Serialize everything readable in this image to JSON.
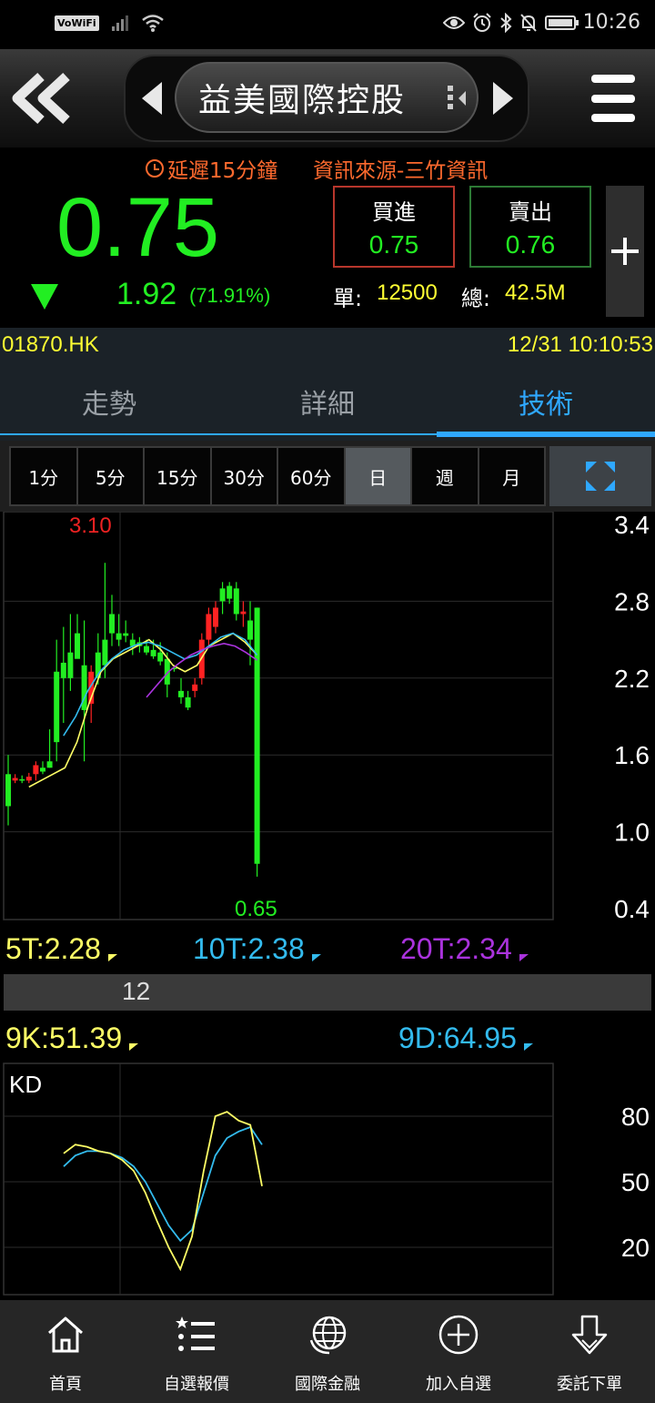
{
  "status_bar": {
    "network": "VoWiFi",
    "time": "10:26"
  },
  "header": {
    "title": "益美國際控股"
  },
  "quote": {
    "delay_note": "延遲15分鐘",
    "source": "資訊來源-三竹資訊",
    "price": "0.75",
    "change": "1.92",
    "change_pct": "(71.91%)",
    "buy_label": "買進",
    "buy_price": "0.75",
    "sell_label": "賣出",
    "sell_price": "0.76",
    "lot_label": "單:",
    "lot_value": "12500",
    "total_label": "總:",
    "total_value": "42.5M"
  },
  "info": {
    "code": "01870.HK",
    "datetime": "12/31 10:10:53"
  },
  "tabs": [
    {
      "label": "走勢"
    },
    {
      "label": "詳細"
    },
    {
      "label": "技術"
    }
  ],
  "active_tab": "技術",
  "periods": [
    {
      "label": "1分"
    },
    {
      "label": "5分"
    },
    {
      "label": "15分"
    },
    {
      "label": "30分"
    },
    {
      "label": "60分"
    },
    {
      "label": "日"
    },
    {
      "label": "週"
    },
    {
      "label": "月"
    }
  ],
  "active_period": "日",
  "price_chart": {
    "y_ticks": [
      "3.4",
      "2.8",
      "2.2",
      "1.6",
      "1.0",
      "0.4"
    ],
    "high_label": "3.10",
    "low_label": "0.65"
  },
  "ma": {
    "ma5": "5T:2.28",
    "ma10": "10T:2.38",
    "ma20": "20T:2.34"
  },
  "month_marker": "12",
  "kd": {
    "k": "9K:51.39",
    "d": "9D:64.95",
    "label": "KD",
    "y_ticks": [
      "80",
      "50",
      "20"
    ]
  },
  "colors": {
    "up": "#ff2222",
    "down": "#22ee22",
    "ma5": "#ffff66",
    "ma10": "#33bbee",
    "ma20": "#aa33dd",
    "accent": "#2fa8ff"
  },
  "chart_data": {
    "type": "candlestick",
    "y_unit": "HKD",
    "ylim": [
      0.4,
      3.4
    ],
    "candles": [
      {
        "o": 1.45,
        "h": 1.6,
        "l": 1.05,
        "c": 1.2
      },
      {
        "o": 1.4,
        "h": 1.45,
        "l": 1.38,
        "c": 1.42
      },
      {
        "o": 1.41,
        "h": 1.44,
        "l": 1.38,
        "c": 1.4
      },
      {
        "o": 1.4,
        "h": 1.46,
        "l": 1.38,
        "c": 1.43
      },
      {
        "o": 1.45,
        "h": 1.55,
        "l": 1.4,
        "c": 1.52
      },
      {
        "o": 1.5,
        "h": 1.55,
        "l": 1.45,
        "c": 1.47
      },
      {
        "o": 1.55,
        "h": 1.8,
        "l": 1.5,
        "c": 1.5
      },
      {
        "o": 2.25,
        "h": 2.5,
        "l": 1.55,
        "c": 1.7
      },
      {
        "o": 2.32,
        "h": 2.6,
        "l": 1.85,
        "c": 2.2
      },
      {
        "o": 2.4,
        "h": 2.7,
        "l": 2.1,
        "c": 2.2
      },
      {
        "o": 2.55,
        "h": 2.7,
        "l": 2.4,
        "c": 2.35
      },
      {
        "o": 2.3,
        "h": 2.65,
        "l": 1.55,
        "c": 1.95
      },
      {
        "o": 2.0,
        "h": 2.3,
        "l": 1.85,
        "c": 2.25
      },
      {
        "o": 2.4,
        "h": 2.55,
        "l": 2.15,
        "c": 2.2
      },
      {
        "o": 2.5,
        "h": 3.1,
        "l": 2.2,
        "c": 2.3
      },
      {
        "o": 2.7,
        "h": 2.85,
        "l": 2.45,
        "c": 2.55
      },
      {
        "o": 2.55,
        "h": 2.7,
        "l": 2.45,
        "c": 2.5
      },
      {
        "o": 2.55,
        "h": 2.65,
        "l": 2.48,
        "c": 2.53
      },
      {
        "o": 2.5,
        "h": 2.55,
        "l": 2.38,
        "c": 2.45
      },
      {
        "o": 2.48,
        "h": 2.52,
        "l": 2.4,
        "c": 2.45
      },
      {
        "o": 2.45,
        "h": 2.5,
        "l": 2.38,
        "c": 2.4
      },
      {
        "o": 2.42,
        "h": 2.5,
        "l": 2.35,
        "c": 2.37
      },
      {
        "o": 2.4,
        "h": 2.48,
        "l": 2.3,
        "c": 2.33
      },
      {
        "o": 2.35,
        "h": 2.4,
        "l": 2.05,
        "c": 2.15
      },
      {
        "o": 2.28,
        "h": 2.3,
        "l": 2.25,
        "c": 2.27
      },
      {
        "o": 2.1,
        "h": 2.2,
        "l": 2.0,
        "c": 2.05
      },
      {
        "o": 2.05,
        "h": 2.1,
        "l": 1.95,
        "c": 1.97
      },
      {
        "o": 2.1,
        "h": 2.2,
        "l": 2.05,
        "c": 2.15
      },
      {
        "o": 2.2,
        "h": 2.55,
        "l": 2.15,
        "c": 2.5
      },
      {
        "o": 2.5,
        "h": 2.75,
        "l": 2.45,
        "c": 2.7
      },
      {
        "o": 2.6,
        "h": 2.8,
        "l": 2.55,
        "c": 2.75
      },
      {
        "o": 2.9,
        "h": 2.95,
        "l": 2.7,
        "c": 2.8
      },
      {
        "o": 2.92,
        "h": 2.95,
        "l": 2.78,
        "c": 2.82
      },
      {
        "o": 2.9,
        "h": 2.95,
        "l": 2.65,
        "c": 2.7
      },
      {
        "o": 2.7,
        "h": 2.8,
        "l": 2.6,
        "c": 2.72
      },
      {
        "o": 2.65,
        "h": 2.8,
        "l": 2.3,
        "c": 2.5
      },
      {
        "o": 2.75,
        "h": 2.75,
        "l": 0.65,
        "c": 0.75
      }
    ],
    "ma5_line": [
      1.35,
      1.4,
      1.45,
      1.5,
      1.7,
      2.0,
      2.25,
      2.35,
      2.4,
      2.45,
      2.5,
      2.42,
      2.3,
      2.25,
      2.3,
      2.45,
      2.5,
      2.55,
      2.48,
      2.38
    ],
    "ma10_line": [
      1.75,
      1.9,
      2.1,
      2.25,
      2.35,
      2.42,
      2.46,
      2.48,
      2.45,
      2.4,
      2.35,
      2.38,
      2.45,
      2.52,
      2.55,
      2.5,
      2.38
    ],
    "ma20_line": [
      2.05,
      2.15,
      2.25,
      2.32,
      2.38,
      2.42,
      2.45,
      2.47,
      2.45,
      2.4,
      2.34
    ],
    "kd_ylim": [
      0,
      100
    ],
    "k_line": [
      63,
      67,
      66,
      64,
      63,
      60,
      55,
      45,
      32,
      20,
      10,
      25,
      55,
      80,
      82,
      78,
      76,
      48
    ],
    "d_line": [
      57,
      62,
      64,
      64,
      63,
      61,
      57,
      50,
      40,
      30,
      23,
      28,
      45,
      62,
      70,
      73,
      75,
      67
    ]
  },
  "bottom_nav": [
    {
      "label": "首頁",
      "icon": "home-icon"
    },
    {
      "label": "自選報價",
      "icon": "list-star-icon"
    },
    {
      "label": "國際金融",
      "icon": "globe-icon"
    },
    {
      "label": "加入自選",
      "icon": "add-circle-icon"
    },
    {
      "label": "委託下單",
      "icon": "order-down-icon"
    }
  ]
}
